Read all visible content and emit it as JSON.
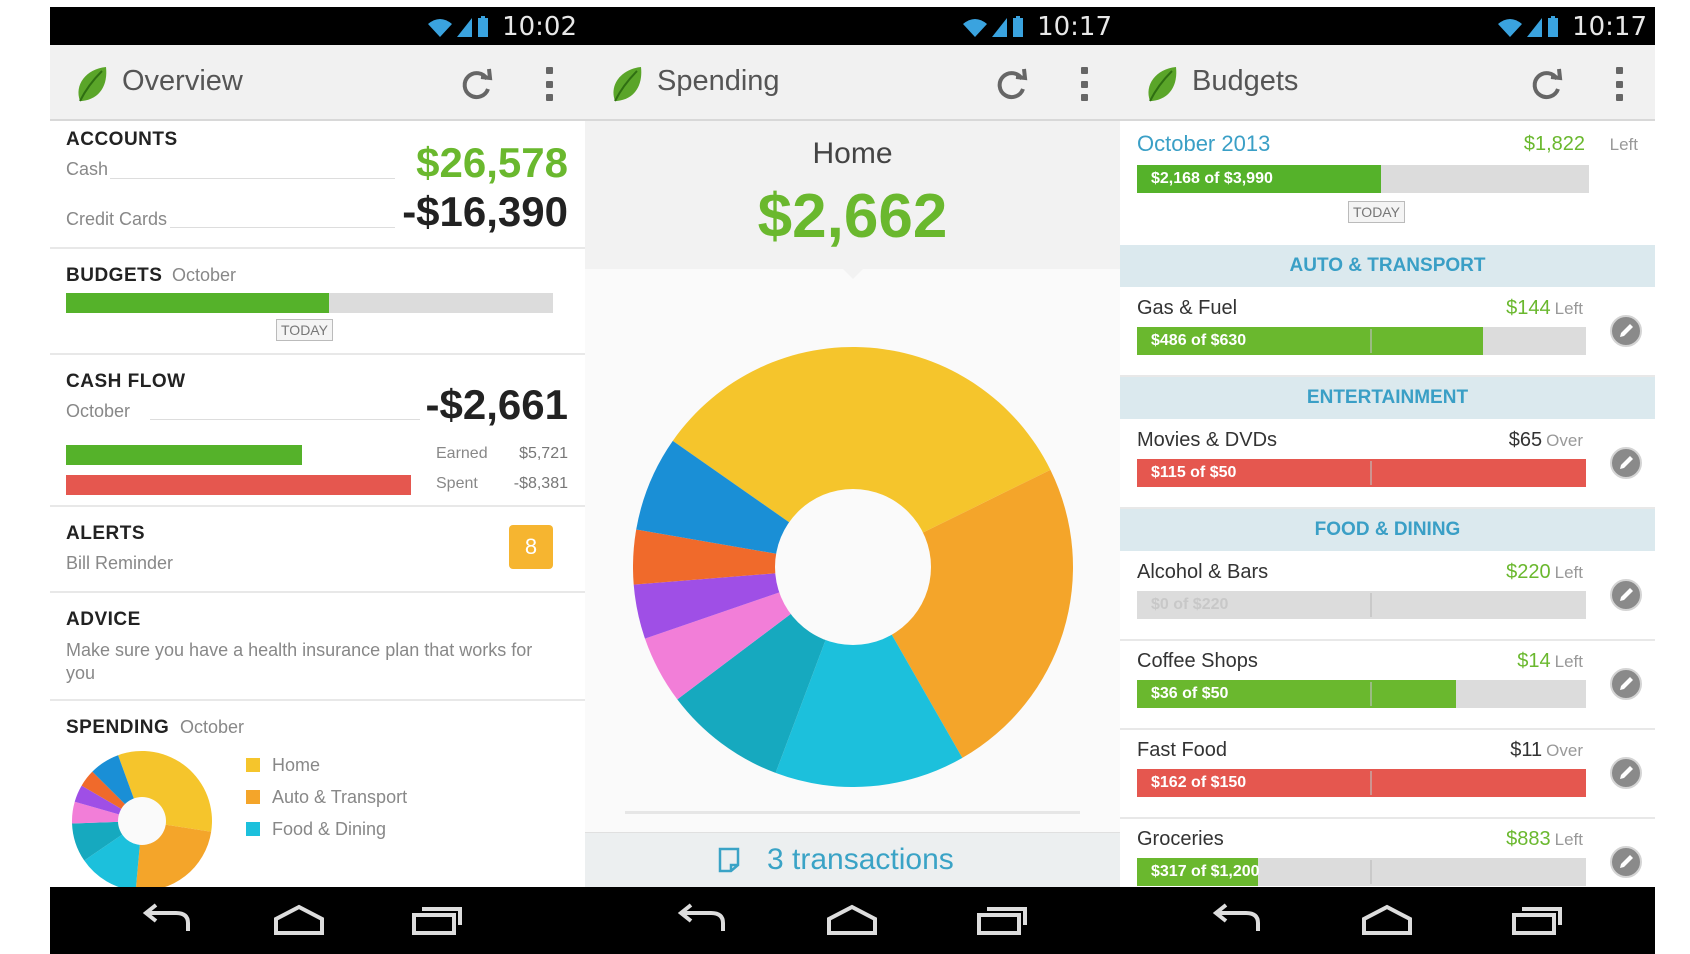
{
  "panels": {
    "overview": {
      "time": "10:02",
      "title": "Overview",
      "accounts": {
        "heading": "ACCOUNTS",
        "cash_label": "Cash",
        "cash_value": "$26,578",
        "credit_label": "Credit Cards",
        "credit_value": "-$16,390"
      },
      "budgets": {
        "heading": "BUDGETS",
        "month": "October",
        "progress": 0.54,
        "today": "TODAY"
      },
      "cash_flow": {
        "heading": "CASH FLOW",
        "month": "October",
        "value": "-$2,661",
        "earned_label": "Earned",
        "earned_value": "$5,721",
        "spent_label": "Spent",
        "spent_value": "-$8,381"
      },
      "alerts": {
        "heading": "ALERTS",
        "sub": "Bill Reminder",
        "count": "8"
      },
      "advice": {
        "heading": "ADVICE",
        "text": "Make sure you have a health insurance plan that works for you"
      },
      "spending": {
        "heading": "SPENDING",
        "month": "October",
        "legend": [
          {
            "label": "Home",
            "color": "#f5c52c"
          },
          {
            "label": "Auto & Transport",
            "color": "#f4a52a"
          },
          {
            "label": "Food & Dining",
            "color": "#1cc0dc"
          }
        ]
      }
    },
    "spending": {
      "time": "10:17",
      "title": "Spending",
      "category": "Home",
      "amount": "$2,662",
      "transactions": "3 transactions"
    },
    "budgets": {
      "time": "10:17",
      "title": "Budgets",
      "month": "October 2013",
      "left_value": "$1,822",
      "left_word": "Left",
      "summary_bar": "$2,168 of $3,990",
      "summary_progress": 0.54,
      "today": "TODAY",
      "sections": [
        {
          "header": "AUTO & TRANSPORT"
        },
        {
          "header": "ENTERTAINMENT"
        },
        {
          "header": "FOOD & DINING"
        }
      ],
      "rows": [
        {
          "name": "Gas & Fuel",
          "value": "$144",
          "word": "Left",
          "bar": "$486 of $630",
          "progress": 0.77,
          "status": "ok"
        },
        {
          "name": "Movies & DVDs",
          "value": "$65",
          "word": "Over",
          "bar": "$115 of $50",
          "progress": 1.0,
          "status": "over"
        },
        {
          "name": "Alcohol & Bars",
          "value": "$220",
          "word": "Left",
          "bar": "$0 of $220",
          "progress": 0.0,
          "status": "ok"
        },
        {
          "name": "Coffee Shops",
          "value": "$14",
          "word": "Left",
          "bar": "$36 of $50",
          "progress": 0.71,
          "status": "ok"
        },
        {
          "name": "Fast Food",
          "value": "$11",
          "word": "Over",
          "bar": "$162 of $150",
          "progress": 1.0,
          "status": "over"
        },
        {
          "name": "Groceries",
          "value": "$883",
          "word": "Left",
          "bar": "$317 of $1,200",
          "progress": 0.27,
          "status": "ok"
        }
      ]
    }
  },
  "colors": {
    "green": "#6ab82e",
    "red": "#e5574f",
    "blue_accent": "#3a9fc6",
    "alert_orange": "#f6b530"
  },
  "chart_data": {
    "type": "pie",
    "title": "Home",
    "slices": [
      {
        "color": "#f5c52c",
        "value": 33
      },
      {
        "color": "#f4a52a",
        "value": 24
      },
      {
        "color": "#1cc0dc",
        "value": 14
      },
      {
        "color": "#16a9bf",
        "value": 9
      },
      {
        "color": "#f27ed8",
        "value": 5
      },
      {
        "color": "#9f4fe6",
        "value": 4
      },
      {
        "color": "#f06a2b",
        "value": 4
      },
      {
        "color": "#1a8fd6",
        "value": 7
      }
    ]
  }
}
